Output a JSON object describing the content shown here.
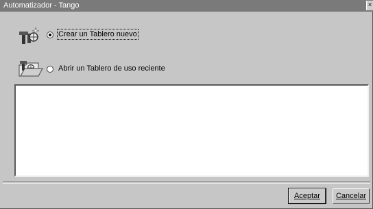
{
  "window": {
    "title": "Automatizador - Tango",
    "close_glyph": "×"
  },
  "options": [
    {
      "label": "Crear un Tablero nuevo",
      "selected": true,
      "icon": "new-board-icon"
    },
    {
      "label": "Abrir un Tablero de uso reciente",
      "selected": false,
      "icon": "open-board-icon"
    }
  ],
  "recent_list": {
    "items": []
  },
  "buttons": {
    "accept_label": "Aceptar",
    "cancel_label": "Cancelar"
  }
}
